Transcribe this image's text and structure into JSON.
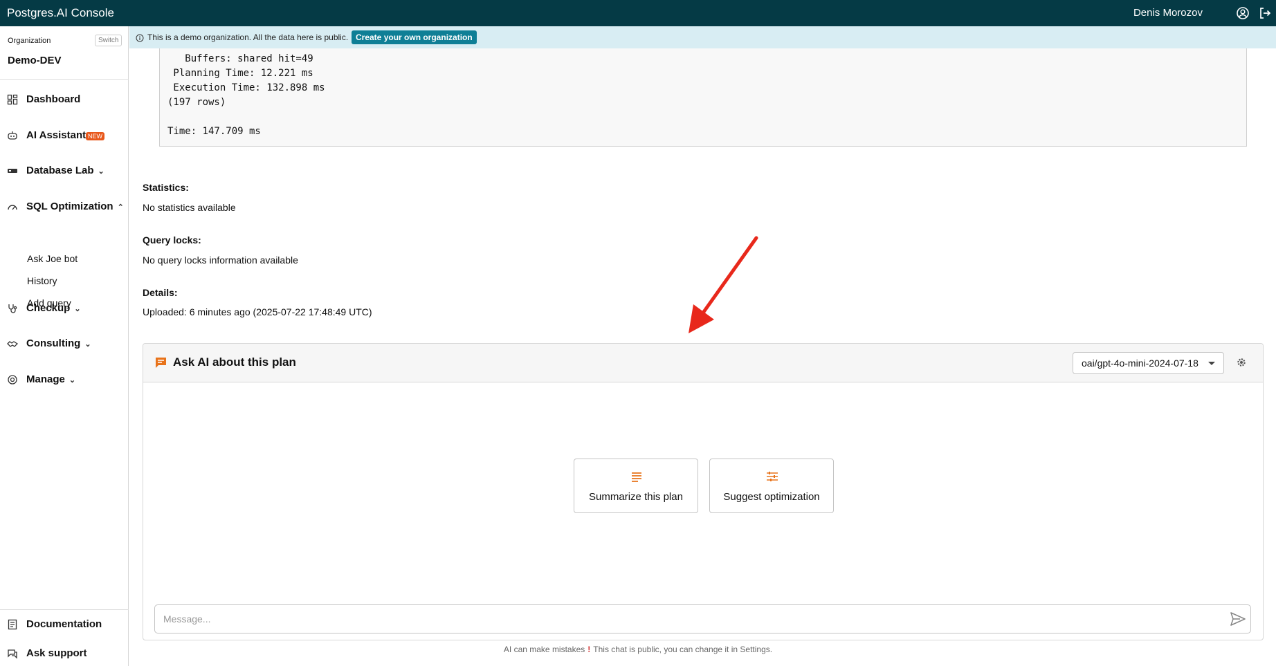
{
  "topbar": {
    "title": "Postgres.AI Console",
    "user": "Denis Morozov"
  },
  "sidebar": {
    "org_label": "Organization",
    "switch_label": "Switch",
    "org_name": "Demo-DEV",
    "items": [
      {
        "label": "Dashboard",
        "icon": "dashboard-icon"
      },
      {
        "label": "AI Assistant",
        "icon": "robot-icon",
        "badge": "NEW"
      },
      {
        "label": "Database Lab",
        "icon": "database-icon"
      },
      {
        "label": "SQL Optimization",
        "icon": "speedometer-icon"
      },
      {
        "label": "Checkup",
        "icon": "stethoscope-icon"
      },
      {
        "label": "Consulting",
        "icon": "handshake-icon"
      },
      {
        "label": "Manage",
        "icon": "settings-icon"
      }
    ],
    "sub_items": [
      "Ask Joe bot",
      "History",
      "Add query"
    ],
    "bottom_items": [
      {
        "label": "Documentation",
        "icon": "docs-icon"
      },
      {
        "label": "Ask support",
        "icon": "chat-icon"
      }
    ]
  },
  "banner": {
    "text": "This is a demo organization. All the data here is public.",
    "button": "Create your own organization"
  },
  "plan": {
    "lines": [
      "   Buffers: shared hit=49",
      " Planning Time: 12.221 ms",
      " Execution Time: 132.898 ms",
      "(197 rows)",
      "Time: 147.709 ms"
    ]
  },
  "sections": {
    "statistics_label": "Statistics:",
    "statistics_value": "No statistics available",
    "locks_label": "Query locks:",
    "locks_value": "No query locks information available",
    "details_label": "Details:",
    "details_value": "Uploaded: 6 minutes ago  (2025-07-22 17:48:49 UTC)"
  },
  "ai_panel": {
    "title": "Ask AI about this plan",
    "model": "oai/gpt-4o-mini-2024-07-18",
    "suggestions": [
      "Summarize this plan",
      "Suggest optimization"
    ],
    "placeholder": "Message...",
    "footnote_before": "AI can make mistakes",
    "footnote_after": "This chat is public, you can change it in Settings."
  },
  "colors": {
    "topbar": "#053a45",
    "accent": "#e8731a",
    "banner": "#d8edf3",
    "banner_button": "#0f7f96",
    "arrow": "#e8281b"
  }
}
